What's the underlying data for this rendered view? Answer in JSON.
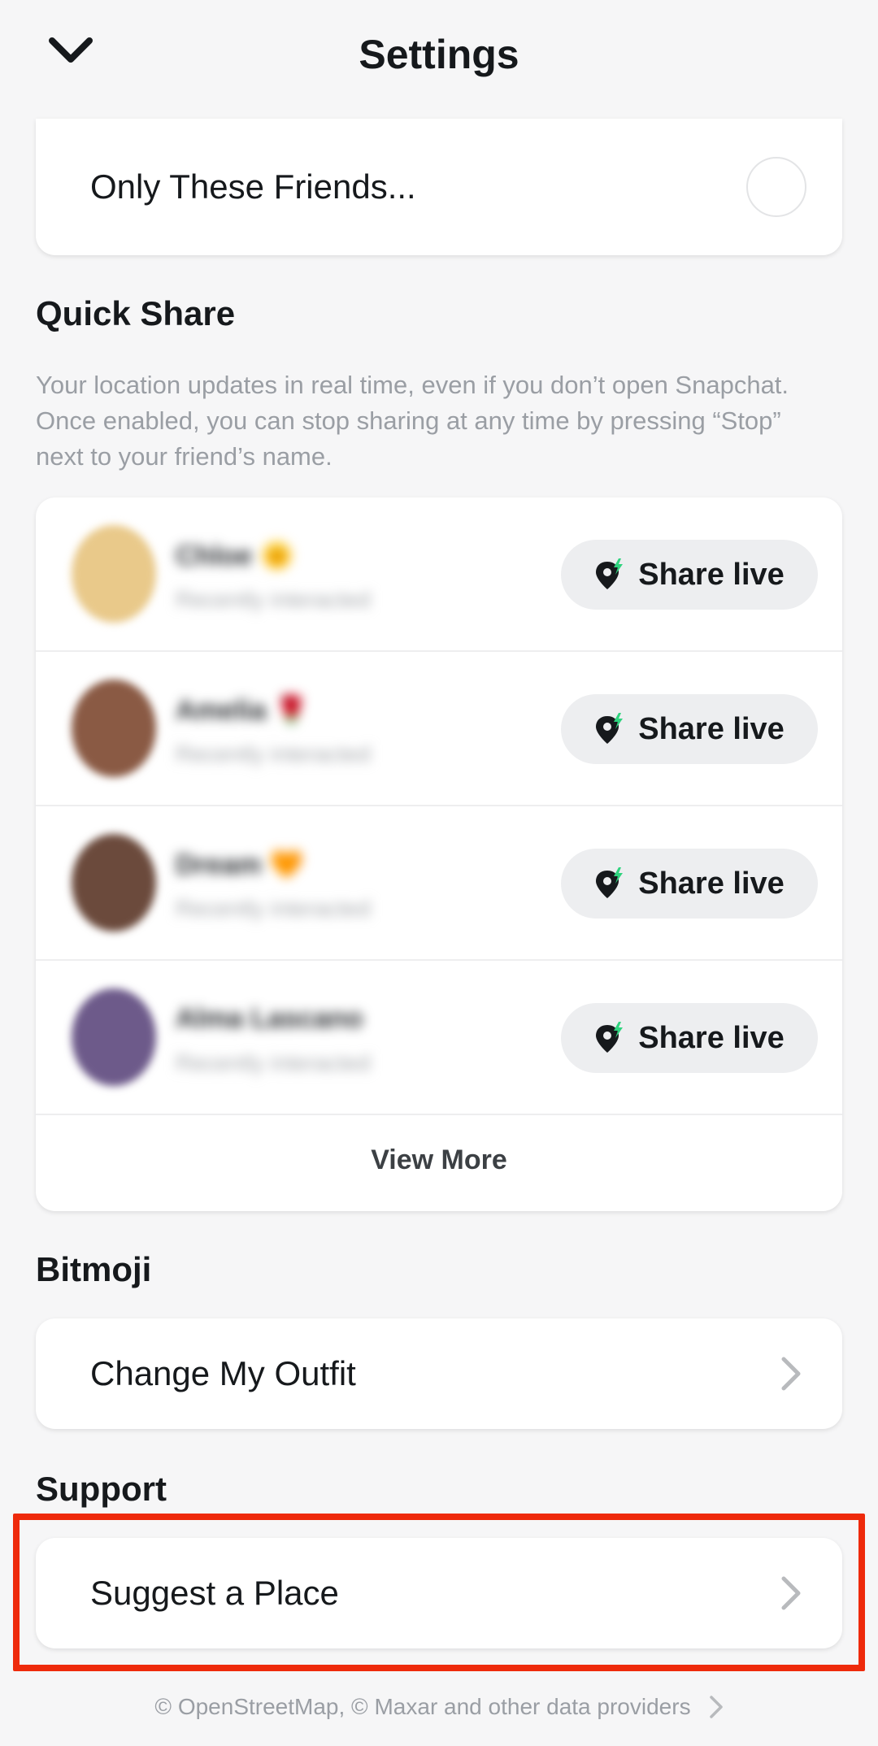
{
  "header": {
    "title": "Settings",
    "back_icon": "chevron-down-icon"
  },
  "visibility": {
    "only_these_friends_label": "Only These Friends..."
  },
  "quick_share": {
    "title": "Quick Share",
    "description": "Your location updates in real time, even if you don’t open Snapchat. Once enabled, you can stop sharing at any time by pressing “Stop” next to your friend’s name.",
    "friends": [
      {
        "name": "Chloe 🌞",
        "subtitle": "Recently interacted",
        "button_label": "Share live",
        "avatar_color": "#e9c98a"
      },
      {
        "name": "Amelia 🌹",
        "subtitle": "Recently interacted",
        "button_label": "Share live",
        "avatar_color": "#8a5a44"
      },
      {
        "name": "Dream 🧡",
        "subtitle": "Recently interacted",
        "button_label": "Share live",
        "avatar_color": "#6b4a3c"
      },
      {
        "name": "Alma Lascano",
        "subtitle": "Recently interacted",
        "button_label": "Share live",
        "avatar_color": "#6d5a8a"
      }
    ],
    "view_more_label": "View More"
  },
  "bitmoji": {
    "title": "Bitmoji",
    "change_outfit_label": "Change My Outfit"
  },
  "support": {
    "title": "Support",
    "suggest_place_label": "Suggest a Place"
  },
  "footer": {
    "attribution": "© OpenStreetMap, © Maxar and other data providers"
  },
  "colors": {
    "highlight": "#ee2a0b",
    "background": "#f6f6f7",
    "pin_accent": "#2fd37e"
  }
}
